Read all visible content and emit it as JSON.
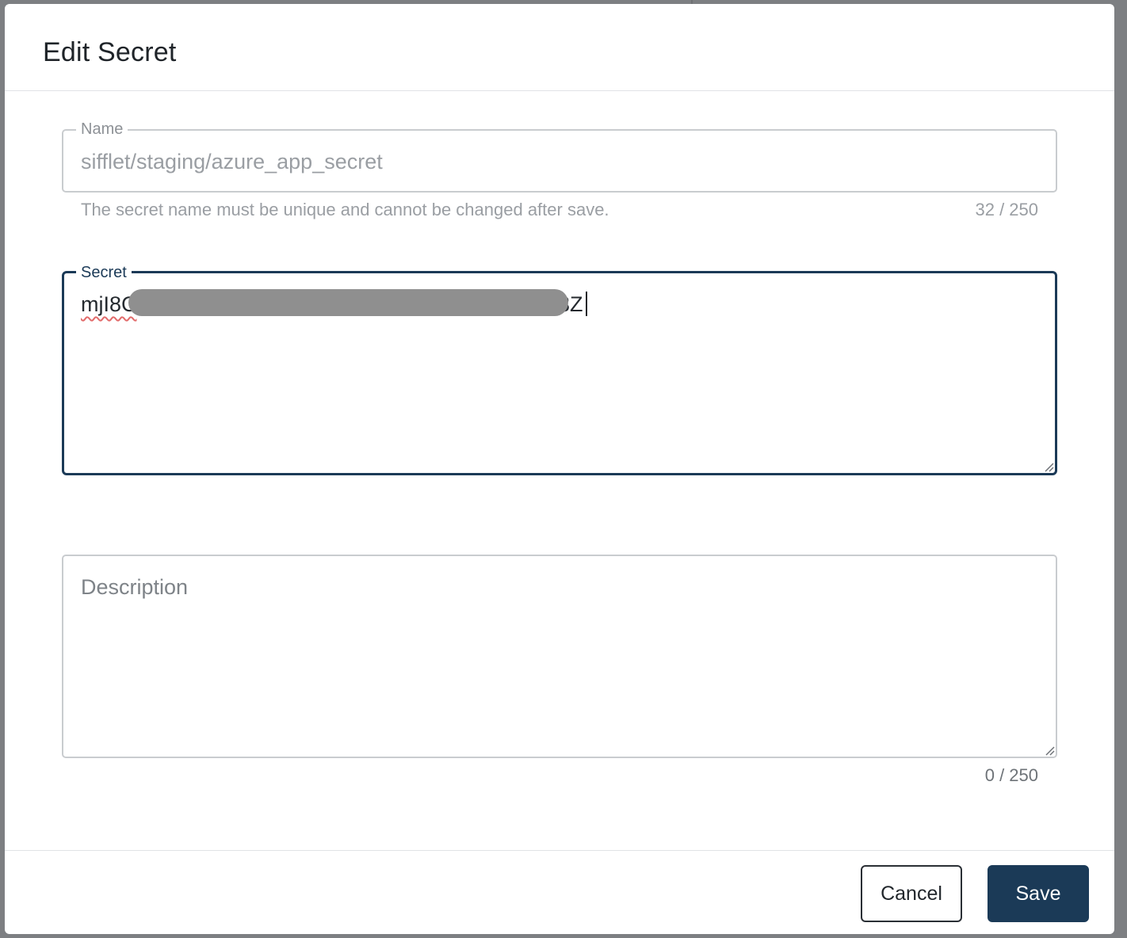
{
  "dialog": {
    "title": "Edit Secret"
  },
  "name_field": {
    "label": "Name",
    "value": "sifflet/staging/azure_app_secret",
    "helper_text": "The secret name must be unique and cannot be changed after save.",
    "counter": "32 / 250"
  },
  "secret_field": {
    "label": "Secret",
    "visible_start": "mjI8C",
    "visible_end": "3Z"
  },
  "description_field": {
    "placeholder": "Description",
    "counter": "0 / 250"
  },
  "footer": {
    "cancel_label": "Cancel",
    "save_label": "Save"
  },
  "colors": {
    "primary": "#1b3a57",
    "redaction": "#8f8f8f",
    "backdrop": "#7d7f82"
  }
}
